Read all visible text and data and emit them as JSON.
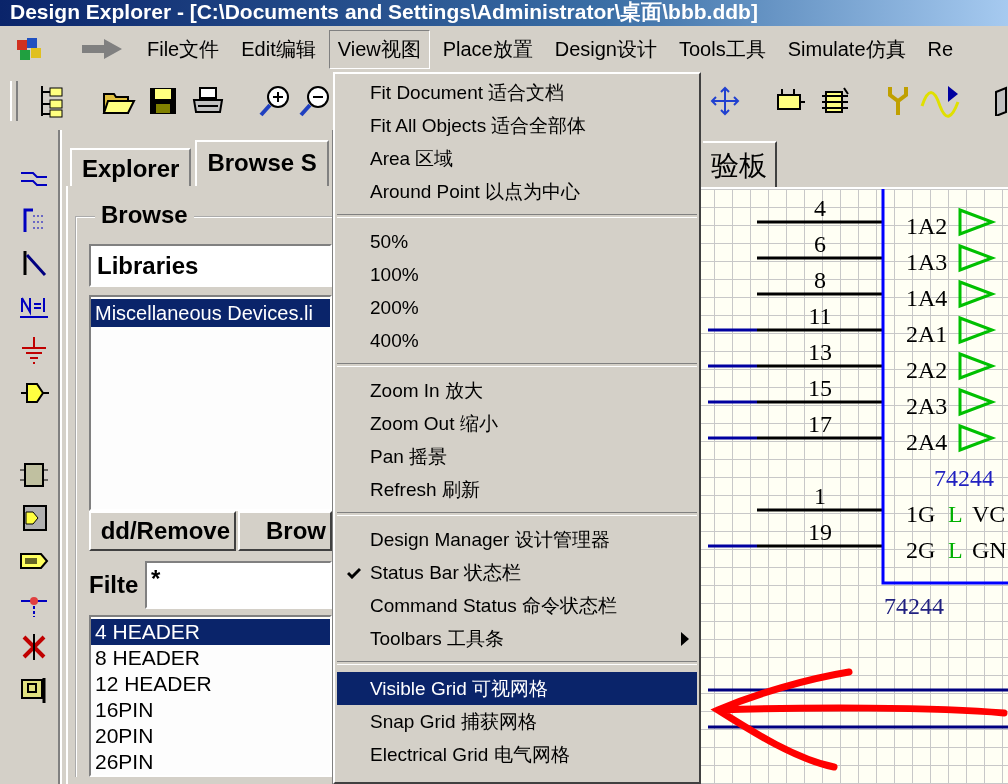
{
  "window": {
    "title": "Design Explorer - [C:\\Documents and Settings\\Administrator\\桌面\\bbb.ddb]"
  },
  "menubar": [
    {
      "label": "File文件",
      "selected": false
    },
    {
      "label": "Edit编辑",
      "selected": false
    },
    {
      "label": "View视图",
      "selected": true
    },
    {
      "label": "Place放置",
      "selected": false
    },
    {
      "label": "Design设计",
      "selected": false
    },
    {
      "label": "Tools工具",
      "selected": false
    },
    {
      "label": "Simulate仿真",
      "selected": false
    },
    {
      "label": "Re",
      "selected": false
    }
  ],
  "view_menu": {
    "items": [
      {
        "kind": "item",
        "label": "Fit Document 适合文档",
        "checked": false,
        "selected": false,
        "submenu": false
      },
      {
        "kind": "item",
        "label": "Fit All Objects 适合全部体",
        "checked": false,
        "selected": false,
        "submenu": false
      },
      {
        "kind": "item",
        "label": "Area 区域",
        "checked": false,
        "selected": false,
        "submenu": false
      },
      {
        "kind": "item",
        "label": "Around Point 以点为中心",
        "checked": false,
        "selected": false,
        "submenu": false
      },
      {
        "kind": "separator"
      },
      {
        "kind": "item",
        "label": "50%",
        "checked": false,
        "selected": false,
        "submenu": false
      },
      {
        "kind": "item",
        "label": "100%",
        "checked": false,
        "selected": false,
        "submenu": false
      },
      {
        "kind": "item",
        "label": "200%",
        "checked": false,
        "selected": false,
        "submenu": false
      },
      {
        "kind": "item",
        "label": "400%",
        "checked": false,
        "selected": false,
        "submenu": false
      },
      {
        "kind": "separator"
      },
      {
        "kind": "item",
        "label": "Zoom In 放大",
        "checked": false,
        "selected": false,
        "submenu": false
      },
      {
        "kind": "item",
        "label": "Zoom Out 缩小",
        "checked": false,
        "selected": false,
        "submenu": false
      },
      {
        "kind": "item",
        "label": "Pan 摇景",
        "checked": false,
        "selected": false,
        "submenu": false
      },
      {
        "kind": "item",
        "label": "Refresh 刷新",
        "checked": false,
        "selected": false,
        "submenu": false
      },
      {
        "kind": "separator"
      },
      {
        "kind": "item",
        "label": "Design Manager 设计管理器",
        "checked": false,
        "selected": false,
        "submenu": false
      },
      {
        "kind": "item",
        "label": "Status Bar 状态栏",
        "checked": true,
        "selected": false,
        "submenu": false
      },
      {
        "kind": "item",
        "label": "Command Status 命令状态栏",
        "checked": false,
        "selected": false,
        "submenu": false
      },
      {
        "kind": "item",
        "label": "Toolbars 工具条",
        "checked": false,
        "selected": false,
        "submenu": true
      },
      {
        "kind": "separator"
      },
      {
        "kind": "item",
        "label": "Visible Grid 可视网格",
        "checked": false,
        "selected": true,
        "submenu": false
      },
      {
        "kind": "item",
        "label": "Snap Grid 捕获网格",
        "checked": false,
        "selected": false,
        "submenu": false
      },
      {
        "kind": "item",
        "label": "Electrical Grid 电气网格",
        "checked": false,
        "selected": false,
        "submenu": false
      }
    ]
  },
  "explorer_panel": {
    "tabs": [
      {
        "label": "Explorer",
        "selected": false
      },
      {
        "label": "Browse S",
        "selected": true
      }
    ],
    "group_title": "Browse",
    "browse_type": "Libraries",
    "libraries": [
      {
        "label": "Miscellaneous Devices.li",
        "selected": true
      }
    ],
    "buttons": [
      "dd/Remove",
      "Brow"
    ],
    "filter": {
      "label": "Filte",
      "value": "*"
    },
    "components": [
      {
        "label": "4 HEADER",
        "selected": true
      },
      {
        "label": "8 HEADER",
        "selected": false
      },
      {
        "label": "12 HEADER",
        "selected": false
      },
      {
        "label": "16PIN",
        "selected": false
      },
      {
        "label": "20PIN",
        "selected": false
      },
      {
        "label": "26PIN",
        "selected": false
      }
    ]
  },
  "document_tabs": [
    {
      "label": "验板",
      "selected": true
    }
  ],
  "schematic": {
    "pins": [
      {
        "number": "4",
        "name": "1A2",
        "kind": "buffer",
        "wired": false
      },
      {
        "number": "6",
        "name": "1A3",
        "kind": "buffer",
        "wired": false
      },
      {
        "number": "8",
        "name": "1A4",
        "kind": "buffer",
        "wired": false
      },
      {
        "number": "11",
        "name": "2A1",
        "kind": "buffer",
        "wired": true
      },
      {
        "number": "13",
        "name": "2A2",
        "kind": "buffer",
        "wired": true
      },
      {
        "number": "15",
        "name": "2A3",
        "kind": "buffer",
        "wired": true
      },
      {
        "number": "17",
        "name": "2A4",
        "kind": "buffer",
        "wired": true
      },
      {
        "number": "1",
        "name": "1G",
        "kind": "enable",
        "wired": false,
        "polarity": "L",
        "power_pin": "VC"
      },
      {
        "number": "19",
        "name": "2G",
        "kind": "enable",
        "wired": true,
        "polarity": "L",
        "power_pin": "GN"
      }
    ],
    "part_type": "74244",
    "designator": "74244"
  }
}
